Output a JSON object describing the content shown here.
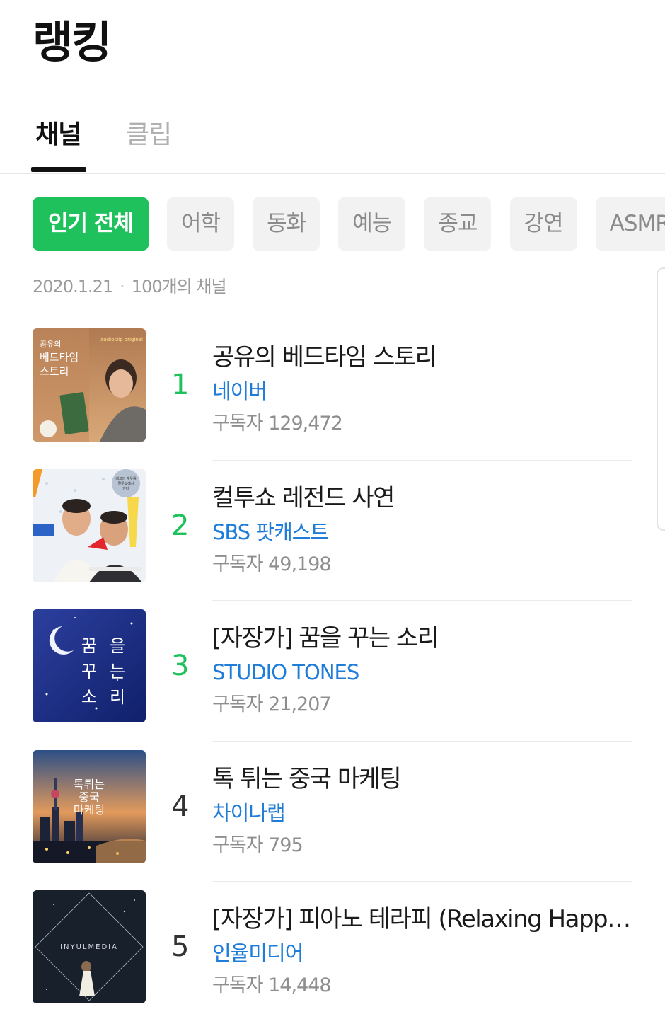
{
  "page": {
    "title": "랭킹"
  },
  "tabs": [
    {
      "label": "채널",
      "active": true
    },
    {
      "label": "클립",
      "active": false
    }
  ],
  "chips": [
    {
      "label": "인기 전체",
      "selected": true
    },
    {
      "label": "어학",
      "selected": false
    },
    {
      "label": "동화",
      "selected": false
    },
    {
      "label": "예능",
      "selected": false
    },
    {
      "label": "종교",
      "selected": false
    },
    {
      "label": "강연",
      "selected": false
    },
    {
      "label": "ASMR·",
      "selected": false
    }
  ],
  "meta": {
    "date": "2020.1.21",
    "count": "100개의 채널"
  },
  "rankings": [
    {
      "rank": "1",
      "title": "공유의 베드타임 스토리",
      "publisher": "네이버",
      "subscribers": "구독자 129,472",
      "thumb": {
        "title_line1": "공유의",
        "title_line2": "베드타임",
        "title_line3": "스토리",
        "badge": "audioclip original"
      }
    },
    {
      "rank": "2",
      "title": "컬투쇼 레전드 사연",
      "publisher": "SBS 팟캐스트",
      "subscribers": "구독자 49,198",
      "thumb": {
        "bubble_line1": "레고의 재우를",
        "bubble_line2": "컬투쇼에서",
        "bubble_line3": "한다"
      }
    },
    {
      "rank": "3",
      "title": "[자장가] 꿈을 꾸는 소리",
      "publisher": "STUDIO TONES",
      "subscribers": "구독자 21,207",
      "thumb": {
        "chars": [
          "꿈",
          "을",
          "꾸",
          "는",
          "소",
          "리"
        ]
      }
    },
    {
      "rank": "4",
      "title": "톡 튀는 중국 마케팅",
      "publisher": "차이나랩",
      "subscribers": "구독자 795",
      "thumb": {
        "line1": "톡튀는",
        "line2": "중국",
        "line3": "마케팅"
      }
    },
    {
      "rank": "5",
      "title": "[자장가] 피아노 테라피 (Relaxing Happy M...",
      "publisher": "인율미디어",
      "subscribers": "구독자 14,448",
      "thumb": {
        "brand": "INYULMEDIA"
      }
    }
  ],
  "colors": {
    "accent_green": "#1ec15c",
    "link_blue": "#1f7cd8"
  }
}
